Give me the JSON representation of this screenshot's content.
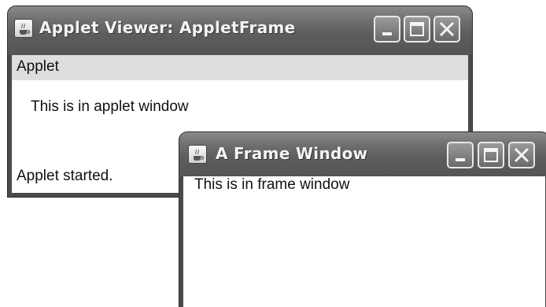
{
  "applet_window": {
    "title": "Applet Viewer: AppletFrame",
    "menu": [
      "Applet"
    ],
    "content_text": "This is in applet window",
    "status_text": "Applet started."
  },
  "frame_window": {
    "title": "A Frame Window",
    "content_text": "This is in frame window"
  },
  "title_bar_buttons": {
    "icons": [
      "minimize-icon",
      "maximize-icon",
      "close-icon"
    ]
  },
  "colors": {
    "title_bar": "#5c5c5c",
    "window_border": "#4a4a4a",
    "menubar": "#dedede",
    "client_background": "#ffffff",
    "title_text": "#f4f4f4"
  }
}
